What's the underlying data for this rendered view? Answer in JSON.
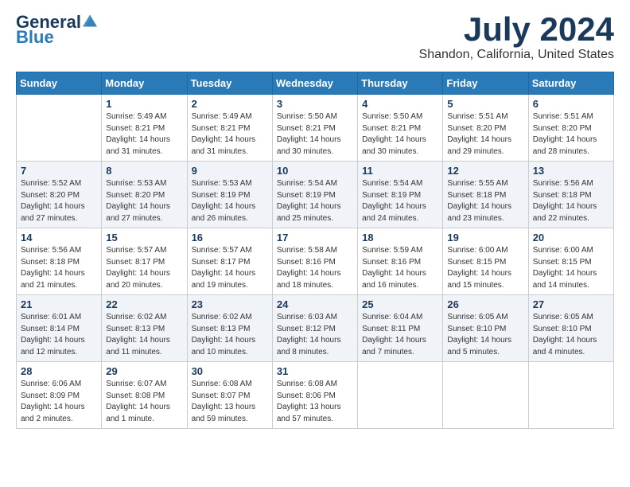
{
  "header": {
    "logo_general": "General",
    "logo_blue": "Blue",
    "month_year": "July 2024",
    "location": "Shandon, California, United States"
  },
  "weekdays": [
    "Sunday",
    "Monday",
    "Tuesday",
    "Wednesday",
    "Thursday",
    "Friday",
    "Saturday"
  ],
  "weeks": [
    [
      {
        "day": "",
        "info": ""
      },
      {
        "day": "1",
        "info": "Sunrise: 5:49 AM\nSunset: 8:21 PM\nDaylight: 14 hours\nand 31 minutes."
      },
      {
        "day": "2",
        "info": "Sunrise: 5:49 AM\nSunset: 8:21 PM\nDaylight: 14 hours\nand 31 minutes."
      },
      {
        "day": "3",
        "info": "Sunrise: 5:50 AM\nSunset: 8:21 PM\nDaylight: 14 hours\nand 30 minutes."
      },
      {
        "day": "4",
        "info": "Sunrise: 5:50 AM\nSunset: 8:21 PM\nDaylight: 14 hours\nand 30 minutes."
      },
      {
        "day": "5",
        "info": "Sunrise: 5:51 AM\nSunset: 8:20 PM\nDaylight: 14 hours\nand 29 minutes."
      },
      {
        "day": "6",
        "info": "Sunrise: 5:51 AM\nSunset: 8:20 PM\nDaylight: 14 hours\nand 28 minutes."
      }
    ],
    [
      {
        "day": "7",
        "info": "Sunrise: 5:52 AM\nSunset: 8:20 PM\nDaylight: 14 hours\nand 27 minutes."
      },
      {
        "day": "8",
        "info": "Sunrise: 5:53 AM\nSunset: 8:20 PM\nDaylight: 14 hours\nand 27 minutes."
      },
      {
        "day": "9",
        "info": "Sunrise: 5:53 AM\nSunset: 8:19 PM\nDaylight: 14 hours\nand 26 minutes."
      },
      {
        "day": "10",
        "info": "Sunrise: 5:54 AM\nSunset: 8:19 PM\nDaylight: 14 hours\nand 25 minutes."
      },
      {
        "day": "11",
        "info": "Sunrise: 5:54 AM\nSunset: 8:19 PM\nDaylight: 14 hours\nand 24 minutes."
      },
      {
        "day": "12",
        "info": "Sunrise: 5:55 AM\nSunset: 8:18 PM\nDaylight: 14 hours\nand 23 minutes."
      },
      {
        "day": "13",
        "info": "Sunrise: 5:56 AM\nSunset: 8:18 PM\nDaylight: 14 hours\nand 22 minutes."
      }
    ],
    [
      {
        "day": "14",
        "info": "Sunrise: 5:56 AM\nSunset: 8:18 PM\nDaylight: 14 hours\nand 21 minutes."
      },
      {
        "day": "15",
        "info": "Sunrise: 5:57 AM\nSunset: 8:17 PM\nDaylight: 14 hours\nand 20 minutes."
      },
      {
        "day": "16",
        "info": "Sunrise: 5:57 AM\nSunset: 8:17 PM\nDaylight: 14 hours\nand 19 minutes."
      },
      {
        "day": "17",
        "info": "Sunrise: 5:58 AM\nSunset: 8:16 PM\nDaylight: 14 hours\nand 18 minutes."
      },
      {
        "day": "18",
        "info": "Sunrise: 5:59 AM\nSunset: 8:16 PM\nDaylight: 14 hours\nand 16 minutes."
      },
      {
        "day": "19",
        "info": "Sunrise: 6:00 AM\nSunset: 8:15 PM\nDaylight: 14 hours\nand 15 minutes."
      },
      {
        "day": "20",
        "info": "Sunrise: 6:00 AM\nSunset: 8:15 PM\nDaylight: 14 hours\nand 14 minutes."
      }
    ],
    [
      {
        "day": "21",
        "info": "Sunrise: 6:01 AM\nSunset: 8:14 PM\nDaylight: 14 hours\nand 12 minutes."
      },
      {
        "day": "22",
        "info": "Sunrise: 6:02 AM\nSunset: 8:13 PM\nDaylight: 14 hours\nand 11 minutes."
      },
      {
        "day": "23",
        "info": "Sunrise: 6:02 AM\nSunset: 8:13 PM\nDaylight: 14 hours\nand 10 minutes."
      },
      {
        "day": "24",
        "info": "Sunrise: 6:03 AM\nSunset: 8:12 PM\nDaylight: 14 hours\nand 8 minutes."
      },
      {
        "day": "25",
        "info": "Sunrise: 6:04 AM\nSunset: 8:11 PM\nDaylight: 14 hours\nand 7 minutes."
      },
      {
        "day": "26",
        "info": "Sunrise: 6:05 AM\nSunset: 8:10 PM\nDaylight: 14 hours\nand 5 minutes."
      },
      {
        "day": "27",
        "info": "Sunrise: 6:05 AM\nSunset: 8:10 PM\nDaylight: 14 hours\nand 4 minutes."
      }
    ],
    [
      {
        "day": "28",
        "info": "Sunrise: 6:06 AM\nSunset: 8:09 PM\nDaylight: 14 hours\nand 2 minutes."
      },
      {
        "day": "29",
        "info": "Sunrise: 6:07 AM\nSunset: 8:08 PM\nDaylight: 14 hours\nand 1 minute."
      },
      {
        "day": "30",
        "info": "Sunrise: 6:08 AM\nSunset: 8:07 PM\nDaylight: 13 hours\nand 59 minutes."
      },
      {
        "day": "31",
        "info": "Sunrise: 6:08 AM\nSunset: 8:06 PM\nDaylight: 13 hours\nand 57 minutes."
      },
      {
        "day": "",
        "info": ""
      },
      {
        "day": "",
        "info": ""
      },
      {
        "day": "",
        "info": ""
      }
    ]
  ]
}
